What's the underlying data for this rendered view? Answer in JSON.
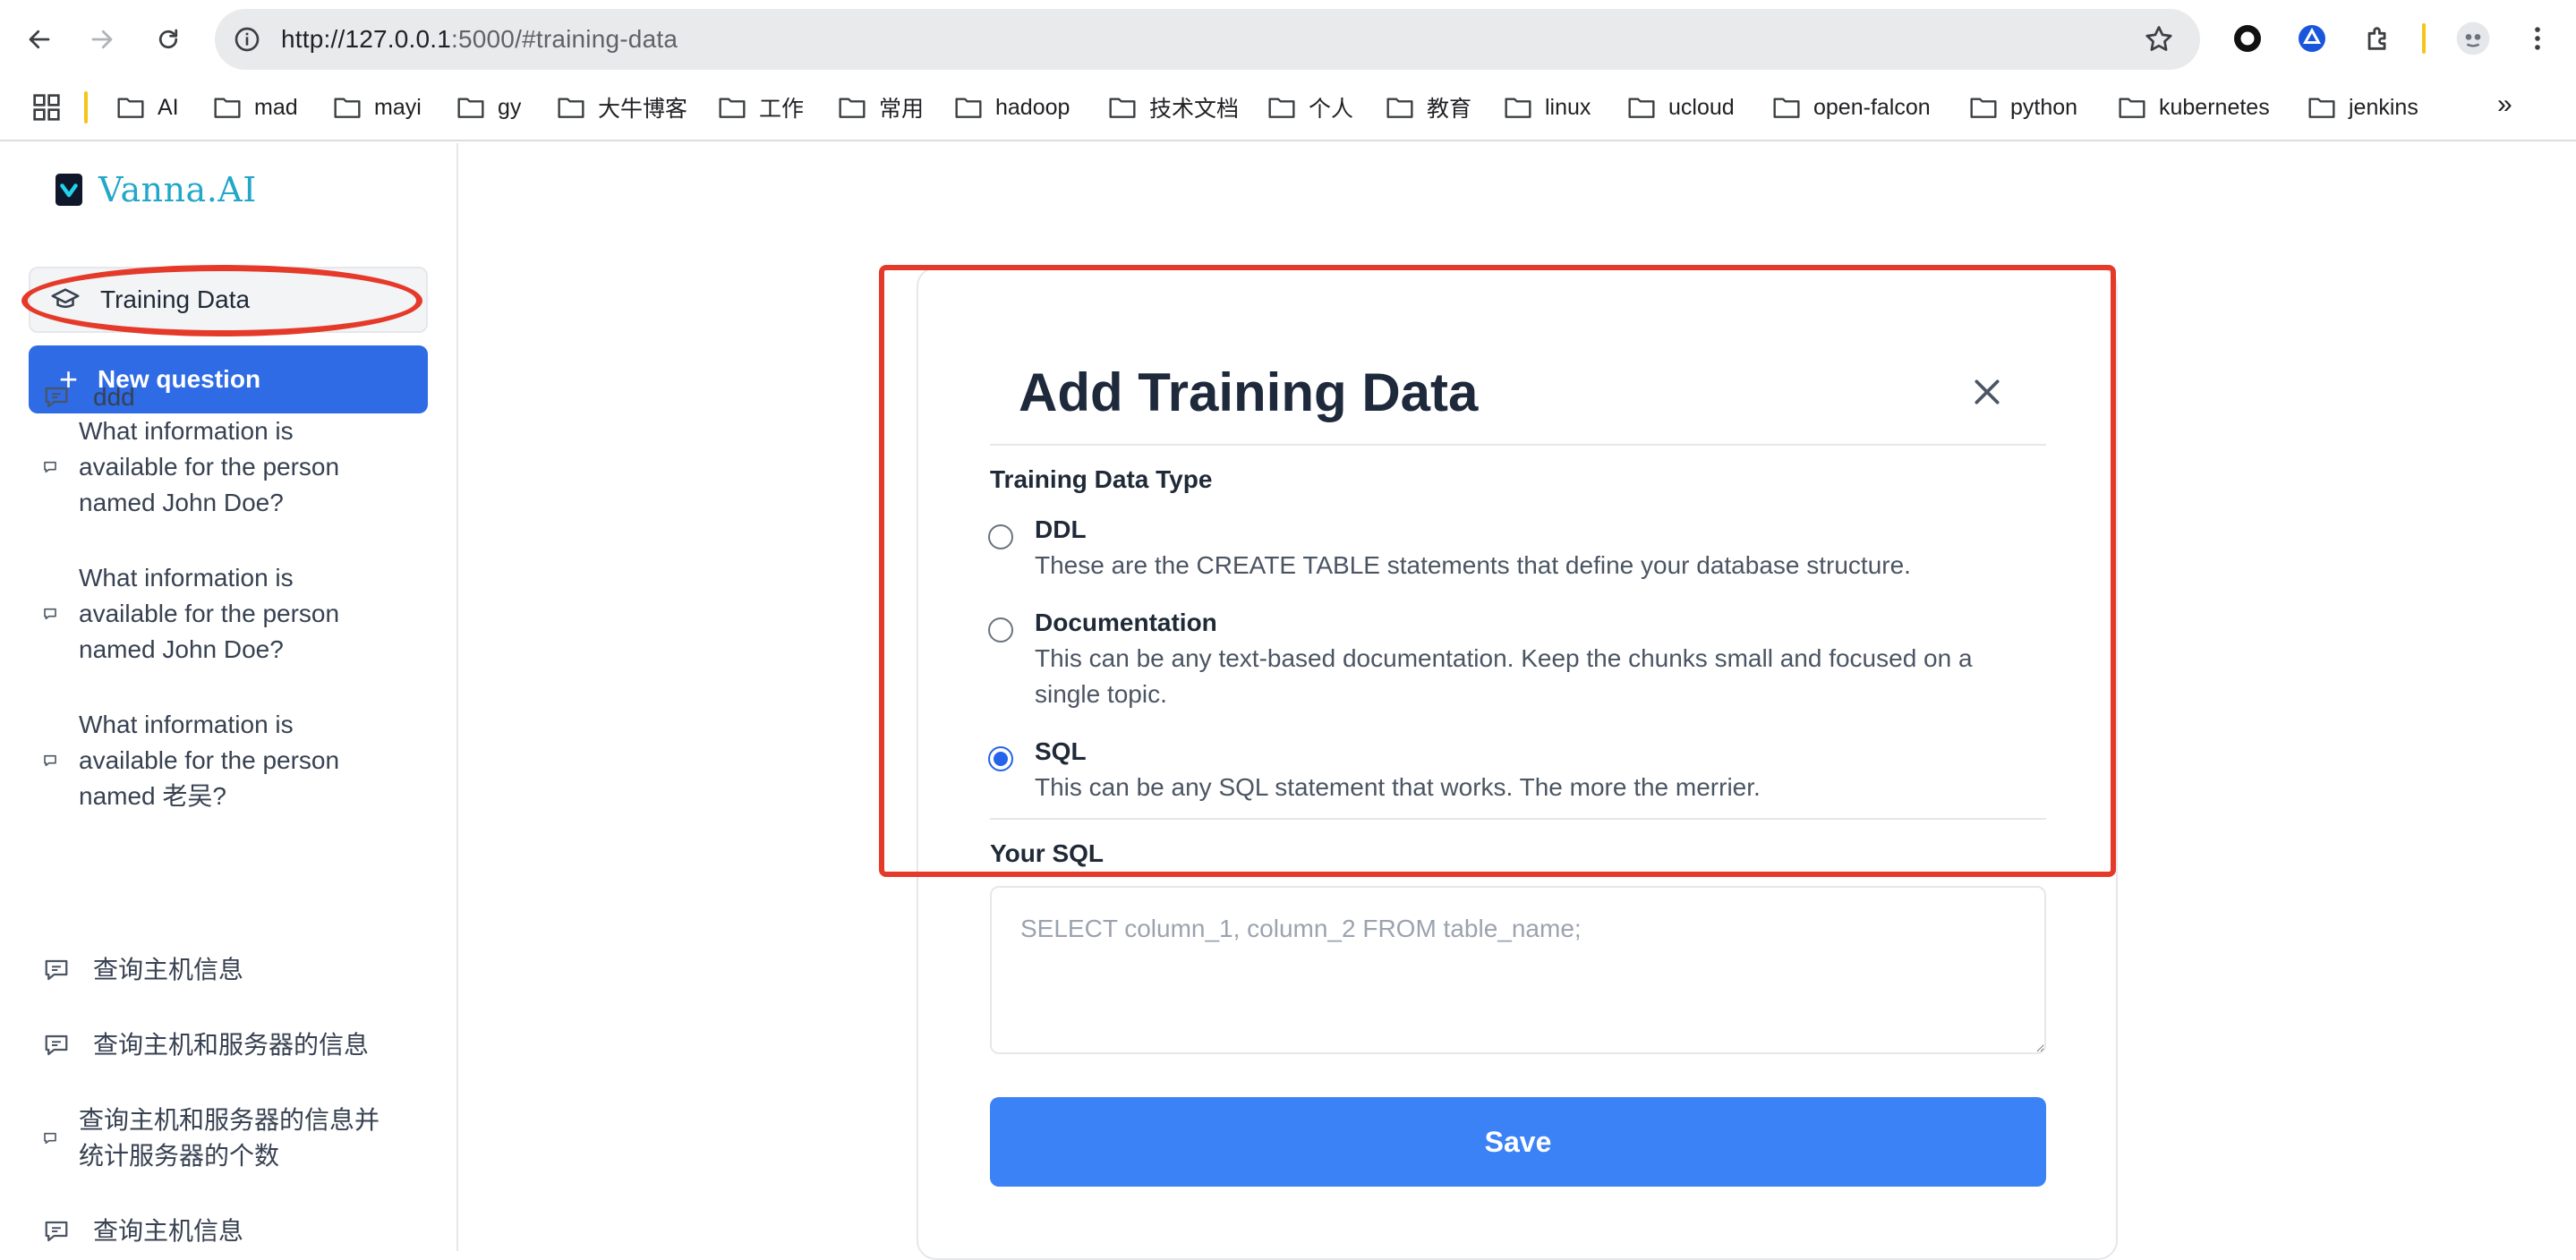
{
  "browser": {
    "url_host": "http://127.0.0.1",
    "url_rest": ":5000/#training-data",
    "icons": [
      "back-icon",
      "forward-icon",
      "reload-icon",
      "site-info-icon",
      "star-icon",
      "extension-icons",
      "profile-avatar",
      "more-menu-icon"
    ],
    "bookmarks": [
      "AI",
      "mad",
      "mayi",
      "gy",
      "大牛博客",
      "工作",
      "常用",
      "hadoop",
      "技术文档",
      "个人",
      "教育",
      "linux",
      "ucloud",
      "open-falcon",
      "python",
      "kubernetes",
      "jenkins"
    ],
    "bookmarks_more": "»"
  },
  "sidebar": {
    "logo_text": "Vanna.AI",
    "training_label": "Training Data",
    "new_question_label": "New question",
    "questions": [
      "ddd",
      "What information is available for the person named John Doe?",
      "What information is available for the person named John Doe?",
      "What information is available for the person named 老吴?",
      "查询主机信息",
      "查询主机和服务器的信息",
      "查询主机和服务器的信息并统计服务器的个数",
      "查询主机信息"
    ]
  },
  "modal": {
    "title": "Add Training Data",
    "type_label": "Training Data Type",
    "options": [
      {
        "title": "DDL",
        "desc": "These are the CREATE TABLE statements that define your database structure.",
        "checked": false
      },
      {
        "title": "Documentation",
        "desc": "This can be any text-based documentation. Keep the chunks small and focused on a single topic.",
        "checked": false
      },
      {
        "title": "SQL",
        "desc": "This can be any SQL statement that works. The more the merrier.",
        "checked": true
      }
    ],
    "sql_label": "Your SQL",
    "sql_placeholder": "SELECT column_1, column_2 FROM table_name;",
    "save_label": "Save"
  },
  "colors": {
    "accent": "#2e6be5",
    "save": "#3b82f6",
    "annotation": "#e53a2a",
    "logo": "#22a7c9"
  }
}
